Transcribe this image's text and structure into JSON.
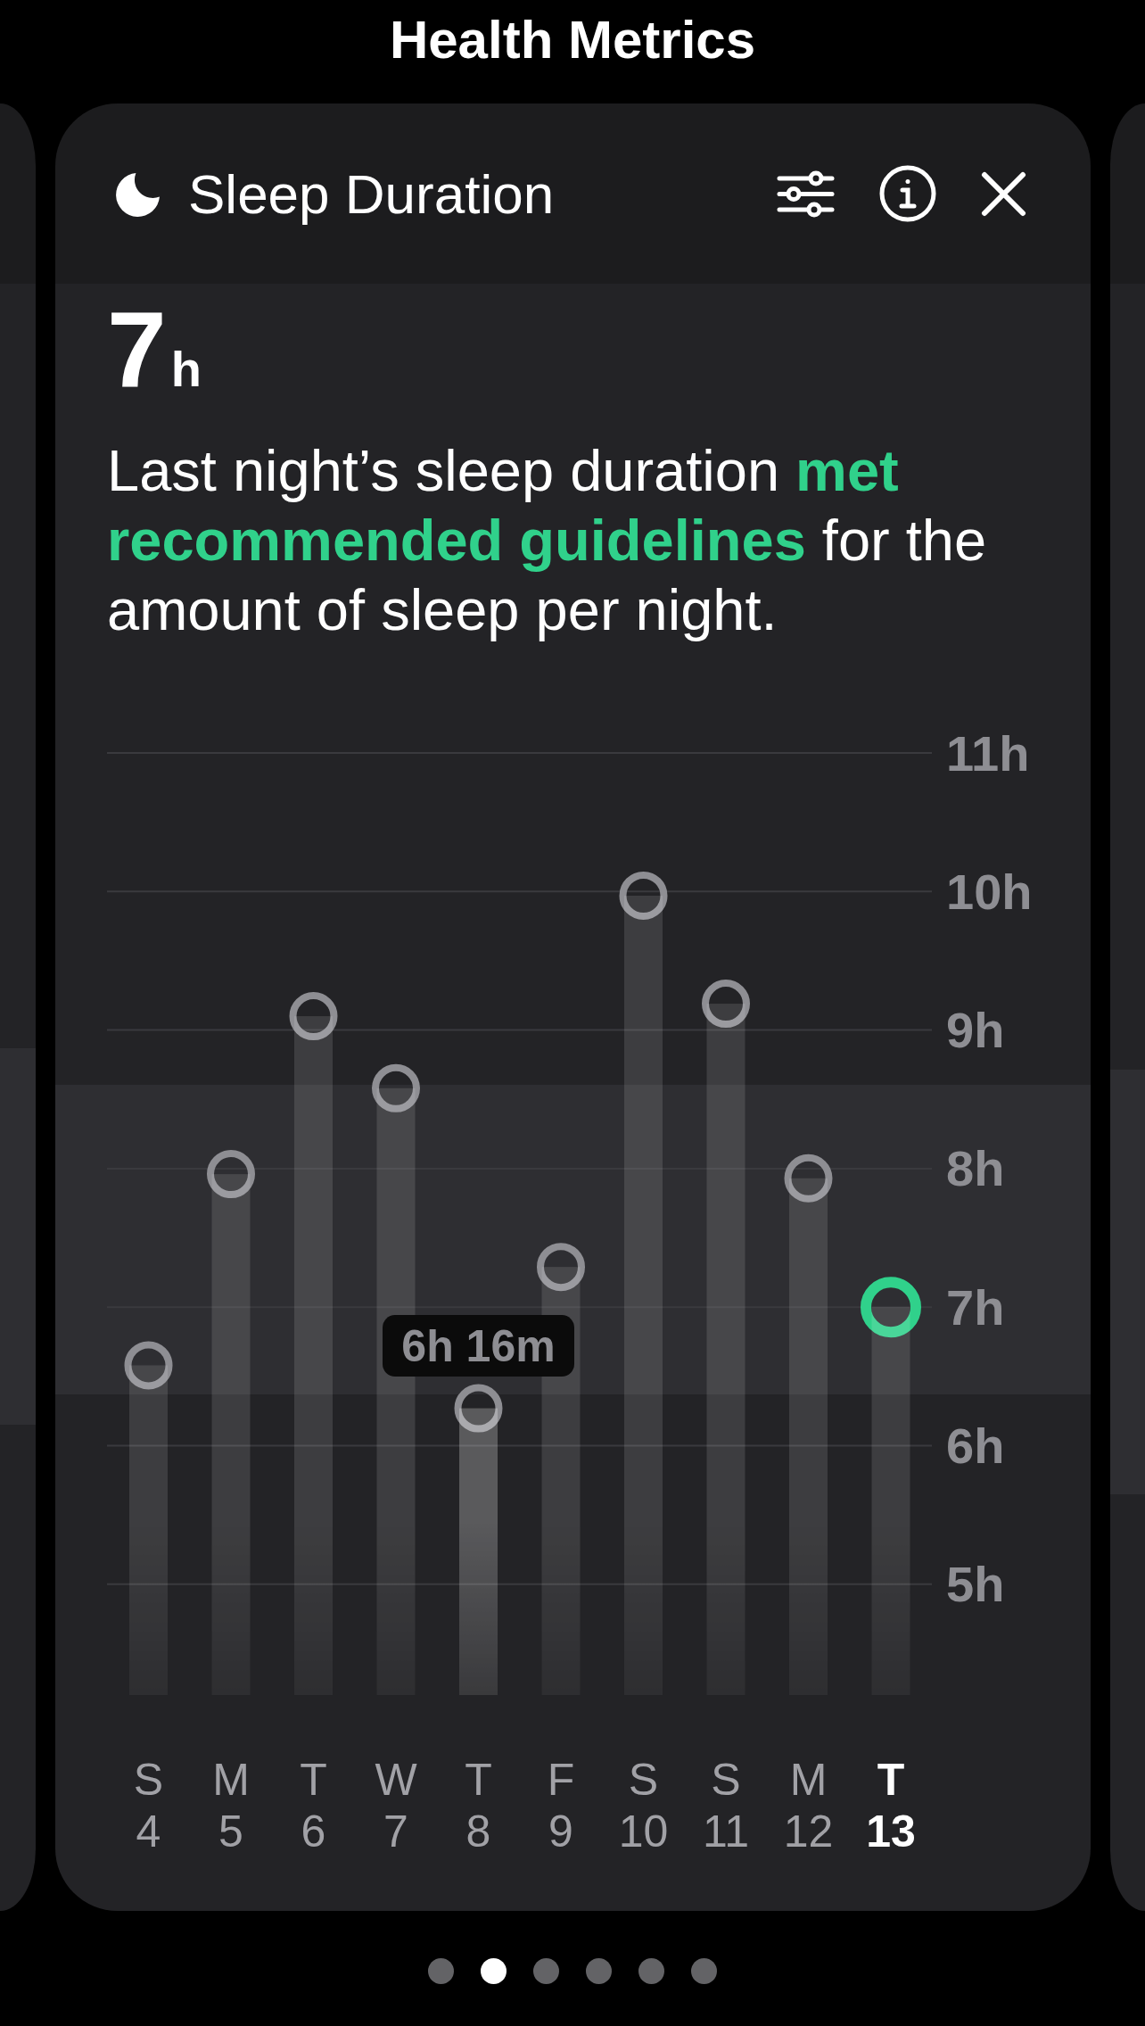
{
  "screen_title": "Health Metrics",
  "card": {
    "title": "Sleep Duration",
    "actions": [
      {
        "kind": "filter"
      },
      {
        "kind": "info"
      },
      {
        "kind": "close"
      }
    ],
    "value": {
      "number": "7",
      "unit": "h"
    },
    "summary": "Last night’s sleep duration **met recommended guidelines** for the amount of sleep per night.",
    "chart": {
      "tooltip": "6h 16m",
      "weekdays": [
        {
          "letter": "S",
          "selected": false,
          "current": false
        },
        {
          "letter": "M",
          "selected": false,
          "current": false
        },
        {
          "letter": "T",
          "selected": false,
          "current": false
        },
        {
          "letter": "W",
          "selected": false,
          "current": false
        },
        {
          "letter": "T",
          "selected": true,
          "current": false
        },
        {
          "letter": "F",
          "selected": false,
          "current": false
        },
        {
          "letter": "S",
          "selected": false,
          "current": false
        },
        {
          "letter": "S",
          "selected": false,
          "current": false
        },
        {
          "letter": "M",
          "selected": false,
          "current": false
        },
        {
          "letter": "T",
          "selected": false,
          "current": true
        }
      ],
      "chart_data": {
        "type": "bar",
        "categories": [
          "4",
          "5",
          "6",
          "7",
          "8",
          "9",
          "10",
          "11",
          "12",
          "13"
        ],
        "values": [
          6.58,
          7.96,
          9.1,
          8.58,
          6.27,
          7.29,
          9.97,
          9.19,
          7.93,
          7
        ],
        "ylim": [
          5,
          11
        ],
        "yticks": [
          {
            "value": 11,
            "label": "11h"
          },
          {
            "value": 10,
            "label": "10h"
          },
          {
            "value": 9,
            "label": "9h"
          },
          {
            "value": 8,
            "label": "8h"
          },
          {
            "value": 7,
            "label": "7h"
          },
          {
            "value": 6,
            "label": "6h"
          },
          {
            "value": 5,
            "label": "5h"
          }
        ],
        "grid": true
      }
    }
  },
  "pages": [
    {
      "selected": false
    },
    {
      "selected": true
    },
    {
      "selected": false
    },
    {
      "selected": false
    },
    {
      "selected": false
    },
    {
      "selected": false
    }
  ]
}
